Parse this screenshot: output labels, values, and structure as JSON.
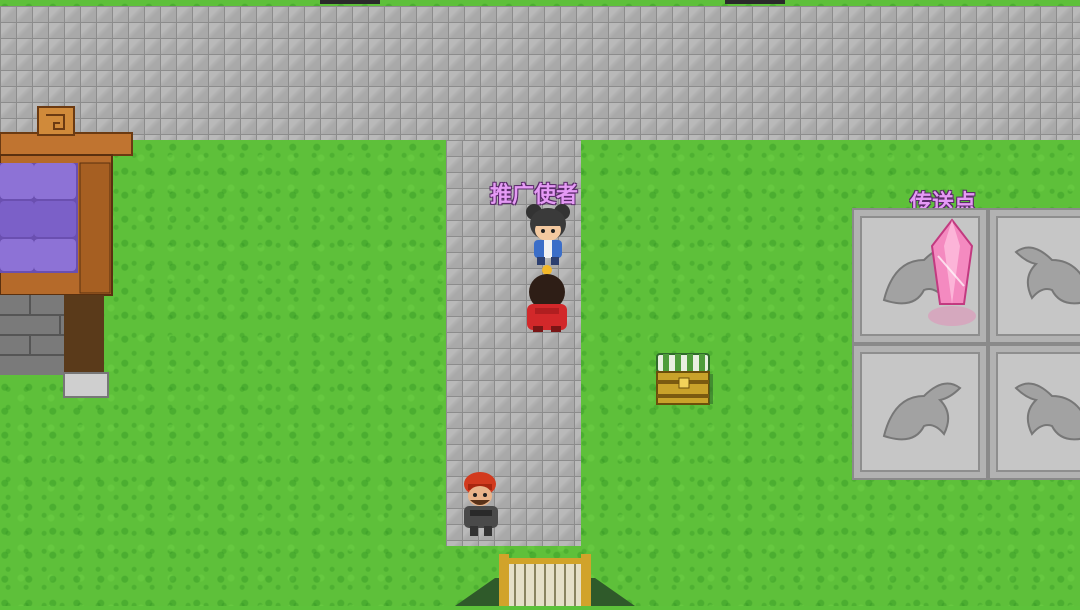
{
  "npc_labels": {
    "promoter": "推广使者",
    "teleport": "传送点"
  },
  "colors": {
    "grass": "#5ec03a",
    "stone": "#a9a9a9",
    "label": "#e59af5",
    "crystal": "#f06fb0"
  }
}
